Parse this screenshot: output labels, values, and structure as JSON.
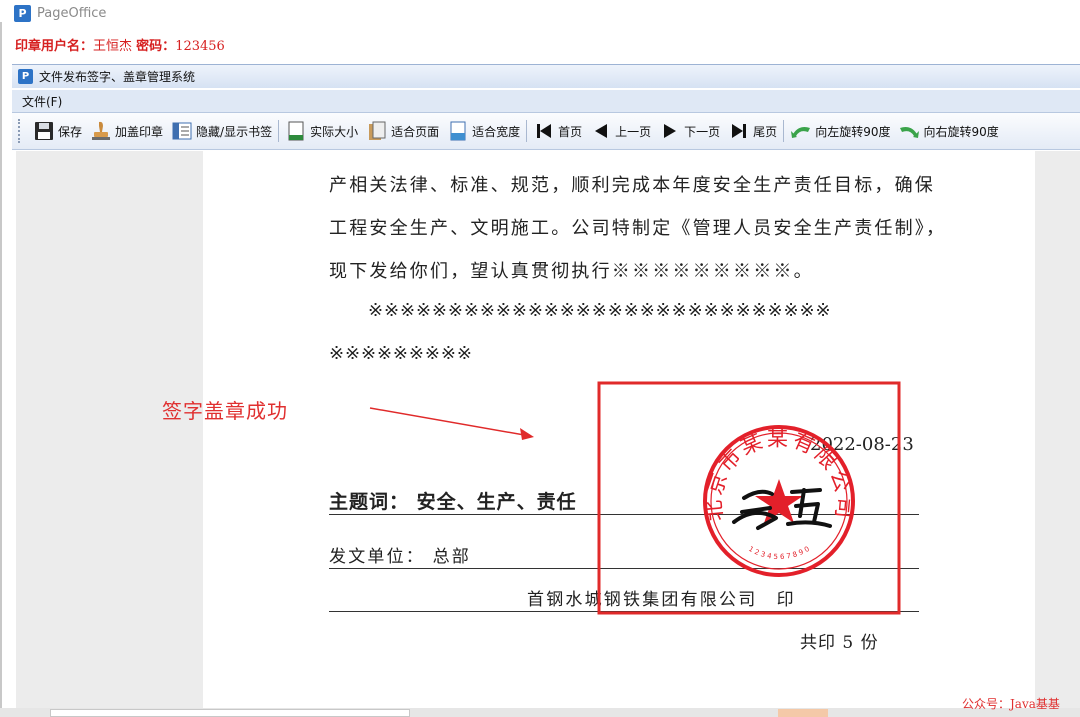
{
  "app": {
    "name": "PageOffice",
    "logo_letter": "P"
  },
  "credentials": {
    "user_label": "印章用户名：",
    "user_value": "王恒杰",
    "password_label": "密码：",
    "password_value": "123456"
  },
  "window": {
    "title": "文件发布签字、盖章管理系统",
    "logo_letter": "P"
  },
  "menu": {
    "file": "文件(F)"
  },
  "toolbar": {
    "save": "保存",
    "add_seal": "加盖印章",
    "toggle_bookmarks": "隐藏/显示书签",
    "actual_size": "实际大小",
    "fit_page": "适合页面",
    "fit_width": "适合宽度",
    "first_page": "首页",
    "prev_page": "上一页",
    "next_page": "下一页",
    "last_page": "尾页",
    "rotate_left": "向左旋转90度",
    "rotate_right": "向右旋转90度"
  },
  "document": {
    "line1": "产相关法律、标准、规范，顺利完成本年度安全生产责任目标，确保",
    "line2": "工程安全生产、文明施工。公司特制定《管理人员安全生产责任制》，",
    "line3": "现下发给你们，望认真贯彻执行※※※※※※※※※。",
    "line4": "※※※※※※※※※※※※※※※※※※※※※※※※※※※※※",
    "line5": "※※※※※※※※※",
    "date": "2022-08-23",
    "subject_label": "主题词：",
    "subject_value": "安全、生产、责任",
    "issuer_label": "发文单位：",
    "issuer_value": "总部",
    "company_print": "首钢水城钢铁集团有限公司　印",
    "copies": "共印 5 份"
  },
  "seal": {
    "text": "北京市某某有限公司",
    "numbers": "1 2 3 4 5 6 7 8 9 0",
    "signature": "王五",
    "color": "#e3202a"
  },
  "annotation": {
    "text": "签字盖章成功",
    "color": "#e03030"
  },
  "watermark": "公众号：Java基基",
  "colors": {
    "toolbar_bg": "#e4ebf6",
    "viewport_bg": "#ececec",
    "credential_red": "#d62020"
  }
}
